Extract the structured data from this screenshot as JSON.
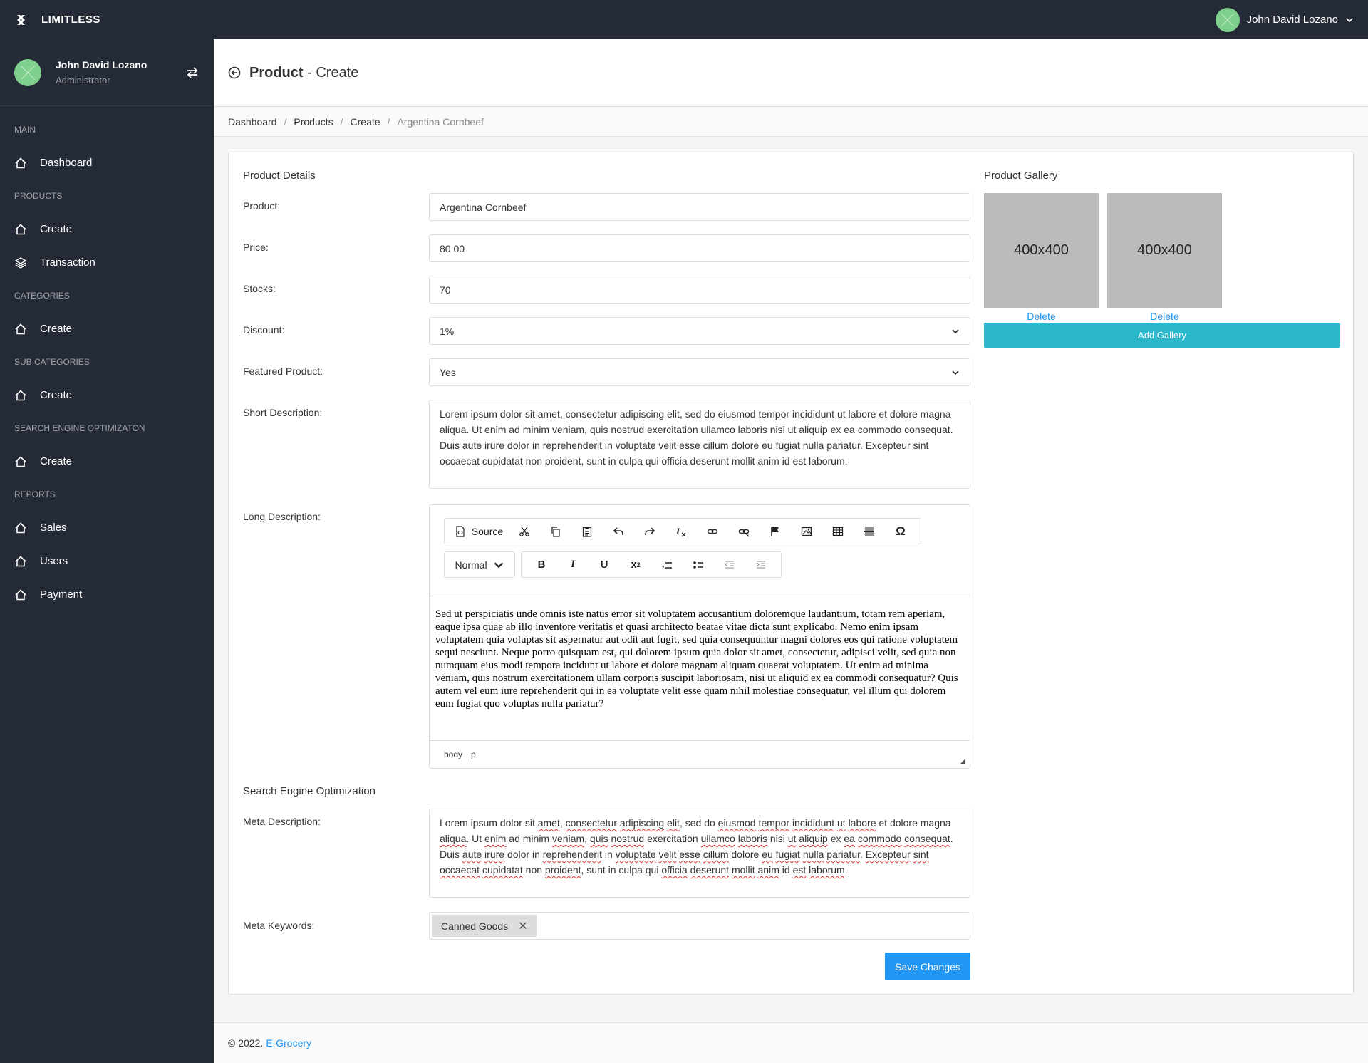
{
  "navbar": {
    "brand": "LIMITLESS",
    "user_name": "John David Lozano"
  },
  "sidebar": {
    "user_name": "John David Lozano",
    "user_role": "Administrator",
    "sections": [
      {
        "header": "MAIN",
        "items": [
          {
            "label": "Dashboard",
            "icon": "home-icon"
          }
        ]
      },
      {
        "header": "PRODUCTS",
        "items": [
          {
            "label": "Create",
            "icon": "home-icon"
          },
          {
            "label": "Transaction",
            "icon": "layers-icon"
          }
        ]
      },
      {
        "header": "CATEGORIES",
        "items": [
          {
            "label": "Create",
            "icon": "home-icon"
          }
        ]
      },
      {
        "header": "SUB CATEGORIES",
        "items": [
          {
            "label": "Create",
            "icon": "home-icon"
          }
        ]
      },
      {
        "header": "SEARCH ENGINE OPTIMIZATON",
        "items": [
          {
            "label": "Create",
            "icon": "home-icon"
          }
        ]
      },
      {
        "header": "REPORTS",
        "items": [
          {
            "label": "Sales",
            "icon": "home-icon"
          },
          {
            "label": "Users",
            "icon": "home-icon"
          },
          {
            "label": "Payment",
            "icon": "home-icon"
          }
        ]
      }
    ]
  },
  "page": {
    "title_bold": "Product",
    "title_rest": " - Create"
  },
  "breadcrumb": [
    "Dashboard",
    "Products",
    "Create",
    "Argentina Cornbeef"
  ],
  "form": {
    "section_title": "Product Details",
    "product_label": "Product:",
    "product_value": "Argentina Cornbeef",
    "price_label": "Price:",
    "price_value": "80.00",
    "stocks_label": "Stocks:",
    "stocks_value": "70",
    "discount_label": "Discount:",
    "discount_value": "1%",
    "featured_label": "Featured Product:",
    "featured_value": "Yes",
    "short_desc_label": "Short Description:",
    "short_desc_value": "Lorem ipsum dolor sit amet, consectetur adipiscing elit, sed do eiusmod tempor incididunt ut labore et dolore magna aliqua. Ut enim ad minim veniam, quis nostrud exercitation ullamco laboris nisi ut aliquip ex ea commodo consequat. Duis aute irure dolor in reprehenderit in voluptate velit esse cillum dolore eu fugiat nulla pariatur. Excepteur sint occaecat cupidatat non proident, sunt in culpa qui officia deserunt mollit anim id est laborum.",
    "long_desc_label": "Long Description:",
    "long_desc_value": "Sed ut perspiciatis unde omnis iste natus error sit voluptatem accusantium doloremque laudantium, totam rem aperiam, eaque ipsa quae ab illo inventore veritatis et quasi architecto beatae vitae dicta sunt explicabo. Nemo enim ipsam voluptatem quia voluptas sit aspernatur aut odit aut fugit, sed quia consequuntur magni dolores eos qui ratione voluptatem sequi nesciunt. Neque porro quisquam est, qui dolorem ipsum quia dolor sit amet, consectetur, adipisci velit, sed quia non numquam eius modi tempora incidunt ut labore et dolore magnam aliquam quaerat voluptatem. Ut enim ad minima veniam, quis nostrum exercitationem ullam corporis suscipit laboriosam, nisi ut aliquid ex ea commodi consequatur? Quis autem vel eum iure reprehenderit qui in ea voluptate velit esse quam nihil molestiae consequatur, vel illum qui dolorem eum fugiat quo voluptas nulla pariatur?",
    "seo_title": "Search Engine Optimization",
    "meta_desc_label": "Meta Description:",
    "meta_keywords_label": "Meta Keywords:",
    "meta_keyword_tag": "Canned Goods",
    "save_label": "Save Changes"
  },
  "editor": {
    "source_label": "Source",
    "format_label": "Normal",
    "path": [
      "body",
      "p"
    ]
  },
  "meta_desc_words": [
    "Lorem ipsum dolor sit ",
    {
      "w": "amet"
    },
    ", ",
    {
      "w": "consectetur"
    },
    " ",
    {
      "w": "adipiscing"
    },
    " ",
    {
      "w": "elit"
    },
    ", sed do ",
    {
      "w": "eiusmod"
    },
    " ",
    {
      "w": "tempor"
    },
    " ",
    {
      "w": "incididunt"
    },
    " ",
    {
      "w": "ut"
    },
    " ",
    {
      "w": "labore"
    },
    " et dolore magna ",
    {
      "w": "aliqua"
    },
    ". Ut ",
    {
      "w": "enim"
    },
    " ad minim ",
    {
      "w": "veniam"
    },
    ", ",
    {
      "w": "quis"
    },
    " ",
    {
      "w": "nostrud"
    },
    " exercitation ",
    {
      "w": "ullamco"
    },
    " ",
    {
      "w": "laboris"
    },
    " nisi ",
    {
      "w": "ut"
    },
    " ",
    {
      "w": "aliquip"
    },
    " ex ",
    {
      "w": "ea"
    },
    " ",
    {
      "w": "commodo"
    },
    " ",
    {
      "w": "consequat"
    },
    ". ",
    "Duis ",
    {
      "w": "aute"
    },
    " ",
    {
      "w": "irure"
    },
    " dolor in ",
    {
      "w": "reprehenderit"
    },
    " in ",
    {
      "w": "voluptate"
    },
    " ",
    {
      "w": "velit"
    },
    " ",
    {
      "w": "esse"
    },
    " ",
    {
      "w": "cillum"
    },
    " dolore ",
    {
      "w": "eu"
    },
    " ",
    {
      "w": "fugiat"
    },
    " ",
    {
      "w": "nulla"
    },
    " ",
    {
      "w": "pariatur"
    },
    ". ",
    {
      "w": "Excepteur"
    },
    " ",
    {
      "w": "sint"
    },
    " ",
    {
      "w": "occaecat"
    },
    " ",
    {
      "w": "cupidatat"
    },
    " non ",
    {
      "w": "proident"
    },
    ", sunt in culpa qui ",
    {
      "w": "officia"
    },
    " ",
    {
      "w": "deserunt"
    },
    " ",
    {
      "w": "mollit"
    },
    " ",
    {
      "w": "anim"
    },
    " id ",
    {
      "w": "est"
    },
    " ",
    {
      "w": "laborum"
    },
    "."
  ],
  "gallery": {
    "title": "Product Gallery",
    "images": [
      {
        "label": "400x400",
        "delete_label": "Delete"
      },
      {
        "label": "400x400",
        "delete_label": "Delete"
      }
    ],
    "add_label": "Add Gallery"
  },
  "footer": {
    "copyright": "© 2022.",
    "link": "E-Grocery"
  }
}
